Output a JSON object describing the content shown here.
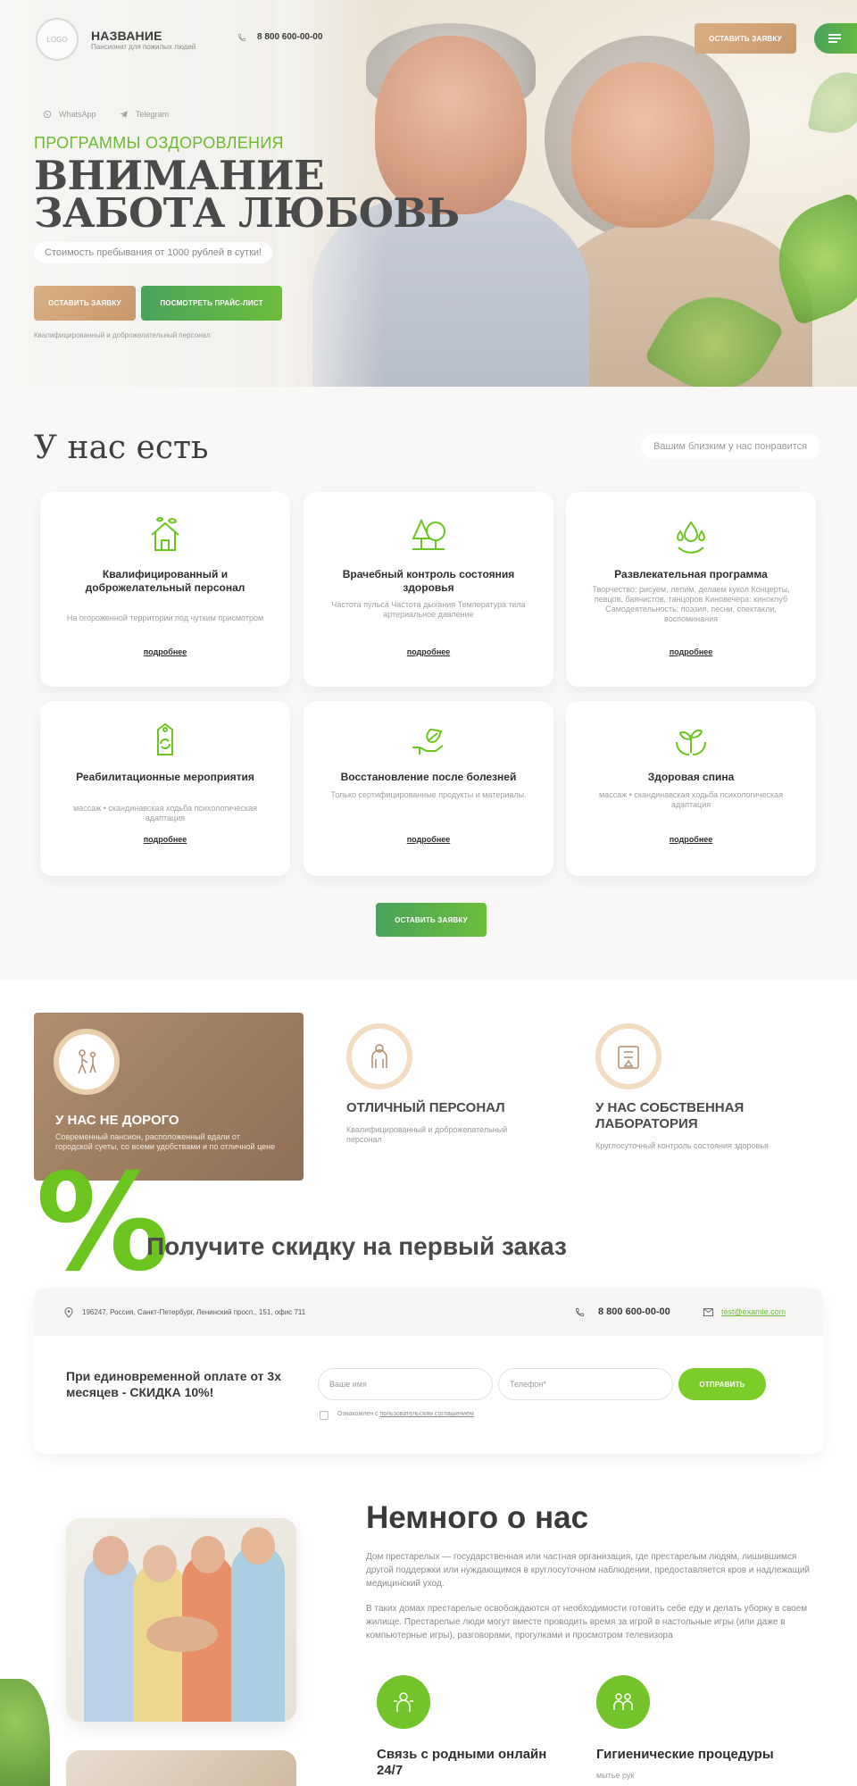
{
  "header": {
    "logo_text": "LOGO",
    "brand_name": "НАЗВАНИЕ",
    "brand_tagline": "Пансионат для пожилых людей",
    "phone": "8 800 600-00-00",
    "cta_button": "ОСТАВИТЬ ЗАЯВКУ",
    "menu_icon": "hamburger-icon"
  },
  "hero": {
    "socials": [
      {
        "label": "WhatsApp",
        "icon": "whatsapp-icon"
      },
      {
        "label": "Telegram",
        "icon": "telegram-icon"
      }
    ],
    "pretitle": "ПРОГРАММЫ ОЗДОРОВЛЕНИЯ",
    "title_line1": "ВНИМАНИЕ",
    "title_line2": "ЗАБОТА ЛЮБОВЬ",
    "price_note": "Стоимость пребывания от 1000 рублей в сутки!",
    "btn_request": "ОСТАВИТЬ ЗАЯВКУ",
    "btn_pricelist": "ПОСМОТРЕТЬ ПРАЙС-ЛИСТ",
    "bottom_note": "Квалифицированный и доброжелательный персонал"
  },
  "features": {
    "title": "У нас есть",
    "subtitle": "Вашим близким у нас понравится",
    "more_label": "подробнее",
    "cta": "ОСТАВИТЬ ЗАЯВКУ",
    "cards": [
      {
        "title": "Квалифицированный и доброжелательный персонал",
        "text": "На огороженной территории под чутким присмотром",
        "icon": "house-plant-icon"
      },
      {
        "title": "Врачебный контроль состояния здоровья",
        "text": "Частота пульса Частота дыхания Температура тела артериальное давление",
        "icon": "trees-icon"
      },
      {
        "title": "Развлекательная программа",
        "text": "Творчество: рисуем, лепим, делаем кукол Концерты, певцов, баянистов, танцоров Киновечера: киноклуб Самодеятельность: поэзия, песни, спектакли, воспоминания",
        "icon": "water-drops-icon"
      },
      {
        "title": "Реабилитационные мероприятия",
        "text": "массаж • скандинавская ходьба психологическая адаптация",
        "icon": "eco-tag-icon"
      },
      {
        "title": "Восстановление после болезней",
        "text": "Только сертифицированные продукты и материалы.",
        "icon": "hand-leaf-icon"
      },
      {
        "title": "Здоровая спина",
        "text": "массаж • скандинавская ходьба психологическая адаптация",
        "icon": "hands-plant-icon"
      }
    ]
  },
  "advantages": [
    {
      "title": "У НАС НЕ ДОРОГО",
      "text": "Современный пансион, расположенный вдали от городской суеты, со всеми удобствами и по отличной цене",
      "icon": "elderly-walking-icon"
    },
    {
      "title": "ОТЛИЧНЫЙ ПЕРСОНАЛ",
      "text": "Квалифицированный и доброжелательный персонал",
      "icon": "staff-icon"
    },
    {
      "title": "У НАС СОБСТВЕННАЯ ЛАБОРАТОРИЯ",
      "text": "Круглосуточный контроль состояния здоровья",
      "icon": "lab-icon"
    }
  ],
  "discount": {
    "symbol": "%",
    "title": "Получите скидку на первый заказ",
    "address": "196247, Россия, Санкт-Петербург, Ленинский просп., 151, офис 711",
    "phone": "8 800 600-00-00",
    "email": "test@examle.com",
    "offer": "При единовременной оплате от 3х месяцев - СКИДКА 10%!",
    "name_placeholder": "Ваше имя",
    "phone_placeholder": "Телефон*",
    "submit": "ОТПРАВИТЬ",
    "agree_prefix": "Ознакомлен с",
    "agree_link": "пользовательским соглашением"
  },
  "about": {
    "title": "Немного о нас",
    "p1": "Дом престарелых — государственная или частная организация, где престарелым людям, лишившимся другой поддержки или нуждающимся в круглосуточном наблюдении, предоставляется кров и надлежащий медицинский уход.",
    "p2": "В таких домах престарелые освобождаются от необходимости готовить себе еду и делать уборку в своем жилище. Престарелые люди могут вместе проводить время за игрой в настольные игры (или даже в компьютерные игры), разговорами, прогулками и просмотром телевизора",
    "services": [
      {
        "title": "Связь с родными онлайн 24/7",
        "text": "",
        "icon": "video-call-icon"
      },
      {
        "title": "Гигиенические процедуры",
        "text": "мытье рук",
        "icon": "hygiene-icon"
      }
    ]
  },
  "colors": {
    "green": "#6cbd3a",
    "tan": "#c8996d",
    "dark_text": "#3a3a3a"
  }
}
